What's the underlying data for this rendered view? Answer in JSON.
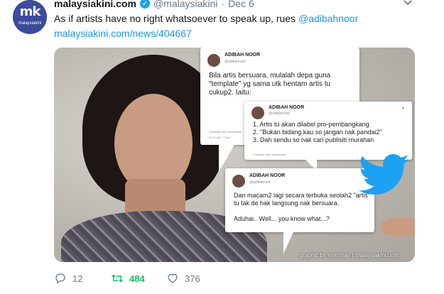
{
  "tweet": {
    "avatar_mark": "mk",
    "avatar_brand": "malaysiakini",
    "display_name": "malaysiakini.com",
    "handle": "@malaysiakini",
    "dot": "·",
    "date": "Dec 6",
    "text_before": "As if artists have no right whatsoever to speak up, rues ",
    "mention": "@adibahnoor",
    "link": "malaysiakini.com/news/404667"
  },
  "media": {
    "bubble1": {
      "name": "ADIBAH NOOR",
      "handle": "@adibahnoor",
      "text": "Bila artis bersuara, mulalah depa guna \"template\" yg sama utk hentam artis tu cukup2. Iaitu:",
      "translate": "Translate from Indonesian",
      "time": "11:27 AM - 7 Dec"
    },
    "bubble2": {
      "name": "ADIBAH NOOR",
      "handle": "@adibahnoor",
      "text": "1. Artis tu akan dilabel pro-pembangkang\n2. \"Bukan bidang kau so jangan nak pandai2\"\n3. Dah sendu so nak cari publisiti murahan",
      "translate": "Translate from Indonesian"
    },
    "bubble3": {
      "name": "ADIBAH NOOR",
      "handle": "@adibahnoor",
      "text": "Dan macam2 lagi secara terbuka seolah2 \"artis\" tu tak de hak langsung nak bersuara.",
      "text2": "Aduhai.. Well... you know what...?"
    },
    "credit": "graphic by syariman | malaysiakini.com"
  },
  "actions": {
    "reply_count": "12",
    "retweet_count": "484",
    "like_count": "376"
  },
  "colors": {
    "link": "#1b95e0",
    "retweeted": "#17bf63",
    "muted": "#657786",
    "verified": "#1da1f2"
  },
  "icons": [
    "verified-badge-icon",
    "chevron-down-icon",
    "reply-icon",
    "retweet-icon",
    "like-icon",
    "twitter-bird-icon"
  ]
}
